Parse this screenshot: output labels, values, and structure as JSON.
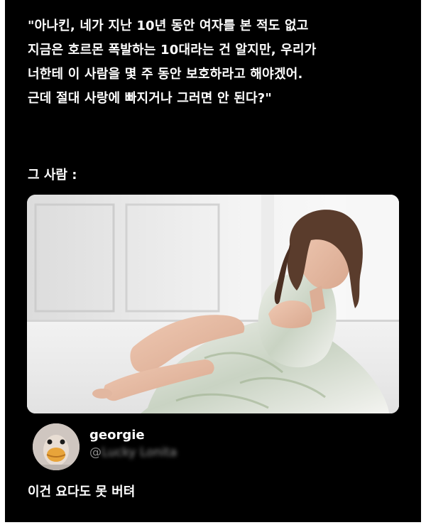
{
  "post": {
    "quote_lines": [
      "\"아나킨, 네가 지난 10년 동안 여자를 본 적도 없고",
      "지금은 호르몬 폭발하는 10대라는 건 알지만, 우리가",
      "너한테 이 사람을 몇 주 동안 보호하라고 해야겠어.",
      "근데 절대 사랑에 빠지거나 그러면 안 된다?\""
    ],
    "caption": "그 사람 :"
  },
  "author": {
    "name": "georgie",
    "handle_prefix": "@",
    "handle_obscured": "Lucky Lonita"
  },
  "reply": {
    "text": "이건 요다도 못 버텨"
  },
  "colors": {
    "background": "#000000",
    "text": "#ffffff",
    "handle": "#8a8a8a"
  },
  "icons": {
    "avatar": "duck-avatar"
  }
}
